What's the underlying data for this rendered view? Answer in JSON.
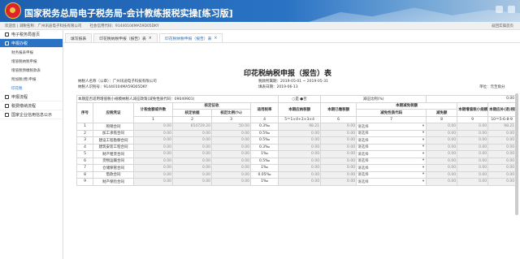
{
  "header": {
    "title": "国家税务总局电子税务局-会计教练报税实操[练习版]"
  },
  "infobar": {
    "welcome": "欢迎您 | 减税名称：广州讯迪电子科技有限公司",
    "tax_id": "社会信用代码：91440104MA59D05DKY",
    "right": "返回实操首页"
  },
  "sidebar": {
    "items": [
      {
        "label": "电子税务局首页"
      },
      {
        "label": "申报办税"
      },
      {
        "sub": [
          "财务报表申报",
          "增值税纳税申报",
          "增值税预缴税款表",
          "附加税(费)申报",
          "印花税"
        ]
      },
      {
        "label": "申报流程"
      },
      {
        "label": "税费缴纳流程"
      },
      {
        "label": "国家企业信用信息公示"
      }
    ]
  },
  "tabs": [
    "填写报表",
    "印花税纳税申报（报告）表",
    "印花税纳税申报（报告）表"
  ],
  "form": {
    "title": "印花税纳税申报（报告）表",
    "taxpayer_name": "纳税人名称（公章）：广州讯迪电子科技有限公司",
    "period": "税款所属期：2019-05-01 ~ 2019-05-31",
    "tax_id": "纳税人识别号：91440104MA59D05DKY",
    "fill_date": "填表日期：2019-06-13",
    "unit": "单位：元至角分",
    "reduction_row": "本期是否适用增值税小规模纳税人减征政策(减免性质代码：09049901)",
    "yes_no": "○是  ●否",
    "ratio_label": "减征比例(%)",
    "ratio_val": "0.00"
  },
  "table": {
    "headers": {
      "seq": "序号",
      "item": "应税凭证",
      "taxable_amount": "计税金额或件数",
      "verified": "核定征收",
      "verified_basis": "核定依据",
      "verified_ratio": "核定比例(%)",
      "rate": "适用税率",
      "payable": "本期应纳税额",
      "paid": "本期已缴税额",
      "exempt": "本期减免税额",
      "exempt_code": "减免性质代码",
      "exempt_amt": "减免额",
      "small_reduce": "本期增值税小规模纳税人减征额",
      "refund": "本期应补(退)税额",
      "formula_payable": "5＝1×4+2×3×4",
      "formula_refund": "10＝5-6-8-9",
      "n1": "1",
      "n2": "2",
      "n3": "3",
      "n4": "4",
      "n6": "6",
      "n7": "7",
      "n8": "8",
      "n9": "9"
    },
    "rows": [
      {
        "seq": "1",
        "item": "购销合同",
        "c1": "0.00",
        "c2": "654729.20",
        "c3": "50.00",
        "rate": "0.3‰",
        "c5": "98.21",
        "c6": "0.00",
        "sel": "请选择",
        "c8": "0.00",
        "c9": "0.00",
        "c10": "98.21"
      },
      {
        "seq": "2",
        "item": "加工承揽合同",
        "c1": "0.00",
        "c2": "0.00",
        "c3": "0.00",
        "rate": "0.5‰",
        "c5": "0.00",
        "c6": "0.00",
        "sel": "请选择",
        "c8": "0.00",
        "c9": "0.00",
        "c10": "0.00"
      },
      {
        "seq": "3",
        "item": "建设工程勘察合同",
        "c1": "0.00",
        "c2": "0.00",
        "c3": "0.00",
        "rate": "0.5‰",
        "c5": "0.00",
        "c6": "0.00",
        "sel": "请选择",
        "c8": "0.00",
        "c9": "0.00",
        "c10": "0.00"
      },
      {
        "seq": "4",
        "item": "建筑安装工程合同",
        "c1": "0.00",
        "c2": "0.00",
        "c3": "0.00",
        "rate": "0.3‰",
        "c5": "0.00",
        "c6": "0.00",
        "sel": "请选择",
        "c8": "0.00",
        "c9": "0.00",
        "c10": "0.00"
      },
      {
        "seq": "5",
        "item": "财产租赁合同",
        "c1": "0.00",
        "c2": "0.00",
        "c3": "0.00",
        "rate": "1‰",
        "c5": "0.00",
        "c6": "0.00",
        "sel": "请选择",
        "c8": "0.00",
        "c9": "0.00",
        "c10": "0.00"
      },
      {
        "seq": "6",
        "item": "货物运输合同",
        "c1": "0.00",
        "c2": "0.00",
        "c3": "0.00",
        "rate": "0.5‰",
        "c5": "0.00",
        "c6": "0.00",
        "sel": "请选择",
        "c8": "0.00",
        "c9": "0.00",
        "c10": "0.00"
      },
      {
        "seq": "7",
        "item": "仓储保管合同",
        "c1": "0.00",
        "c2": "0.00",
        "c3": "0.00",
        "rate": "1‰",
        "c5": "0.00",
        "c6": "0.00",
        "sel": "请选择",
        "c8": "0.00",
        "c9": "0.00",
        "c10": "0.00"
      },
      {
        "seq": "8",
        "item": "借款合同",
        "c1": "0.00",
        "c2": "0.00",
        "c3": "0.00",
        "rate": "0.05‰",
        "c5": "0.00",
        "c6": "0.00",
        "sel": "请选择",
        "c8": "0.00",
        "c9": "0.00",
        "c10": "0.00"
      },
      {
        "seq": "9",
        "item": "财产保险合同",
        "c1": "0.00",
        "c2": "0.00",
        "c3": "0.00",
        "rate": "1‰",
        "c5": "0.00",
        "c6": "0.00",
        "sel": "请选择",
        "c8": "0.00",
        "c9": "0.00",
        "c10": "0.00"
      }
    ]
  }
}
